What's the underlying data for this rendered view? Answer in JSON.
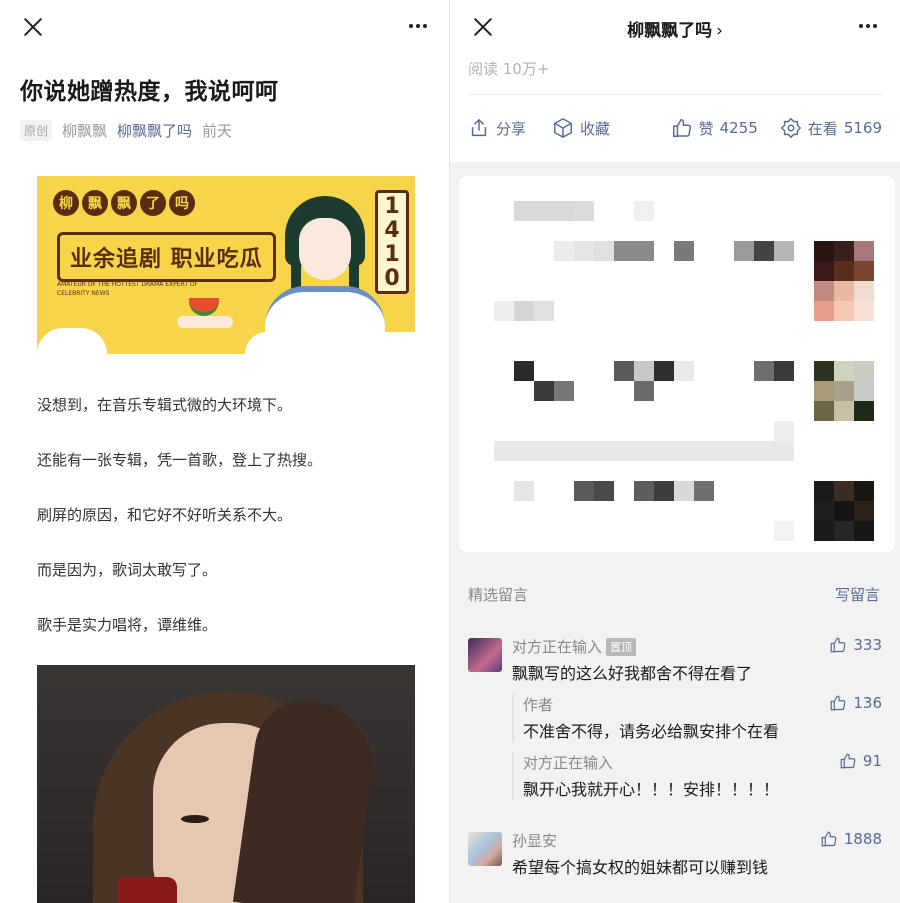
{
  "left": {
    "close_icon": "close-icon",
    "more_icon": "more-icon",
    "article": {
      "title": "你说她蹭热度，我说呵呵",
      "original_badge": "原创",
      "author": "柳飘飘",
      "account": "柳飘飘了吗",
      "time": "前天"
    },
    "banner": {
      "logo_chars": [
        "柳",
        "飘",
        "飘",
        "了",
        "吗"
      ],
      "slogan": "业余追剧 职业吃瓜",
      "tagline": "AMATEUR OF THE HOTTEST DRAMA EXPERT OF CELEBRITY NEWS",
      "number": "1410"
    },
    "paragraphs": [
      "没想到，在音乐专辑式微的大环境下。",
      "还能有一张专辑，凭一首歌，登上了热搜。",
      "刷屏的原因，和它好不好听关系不大。",
      "而是因为，歌词太敢写了。",
      "歌手是实力唱将，谭维维。"
    ]
  },
  "right": {
    "header_title": "柳飘飘了吗",
    "header_chevron": "›",
    "read_count": "阅读 10万+",
    "actions": {
      "share": "分享",
      "favorite": "收藏",
      "like_label": "赞",
      "like_count": "4255",
      "watch_label": "在看",
      "watch_count": "5169"
    },
    "comments_label": "精选留言",
    "write_comment": "写留言",
    "comments": [
      {
        "name": "对方正在输入",
        "badge": "置顶",
        "text": "飘飘写的这么好我都舍不得在看了",
        "likes": "333"
      },
      {
        "name": "作者",
        "text": "不准舍不得，请务必给飘安排个在看",
        "likes": "136"
      },
      {
        "name": "对方正在输入",
        "text": "飘开心我就开心！！！安排！！！！",
        "likes": "91"
      },
      {
        "name": "孙显安",
        "text": "希望每个搞女权的姐妹都可以赚到钱",
        "likes": "1888"
      }
    ]
  },
  "colors": {
    "link_blue": "#576b95",
    "banner_yellow": "#f6d54a",
    "banner_brown": "#5b2c12"
  }
}
